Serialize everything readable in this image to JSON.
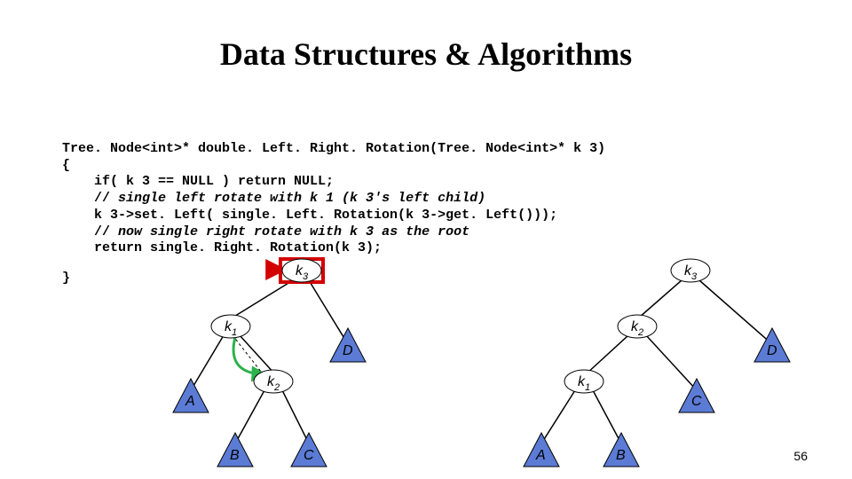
{
  "title": "Data Structures & Algorithms",
  "code": {
    "l1": "Tree. Node<int>* double. Left. Right. Rotation(Tree. Node<int>* k 3)",
    "l2": "{",
    "l3": "    if( k 3 == NULL ) return NULL;",
    "l4_prefix": "    // ",
    "l4_comment": "single left rotate with k 1 (k 3's left child)",
    "l5": "    k 3->set. Left( single. Left. Rotation(k 3->get. Left()));",
    "l6_prefix": "    // ",
    "l6_comment": "now single right rotate with k 3 as the root",
    "l7": "    return single. Right. Rotation(k 3);",
    "l8": "}"
  },
  "left_tree": {
    "root": {
      "base": "k",
      "sub": "3"
    },
    "n1": {
      "base": "k",
      "sub": "1"
    },
    "n2": {
      "base": "k",
      "sub": "2"
    },
    "tri_d": "D",
    "tri_a": "A",
    "tri_b": "B",
    "tri_c": "C"
  },
  "right_tree": {
    "root": {
      "base": "k",
      "sub": "3"
    },
    "n2": {
      "base": "k",
      "sub": "2"
    },
    "n1": {
      "base": "k",
      "sub": "1"
    },
    "tri_d": "D",
    "tri_a": "A",
    "tri_b": "B",
    "tri_c": "C"
  },
  "colors": {
    "node_stroke": "#000000",
    "node_fill": "#ffffff",
    "tri_fill": "#5b7bd5",
    "tri_stroke": "#000000",
    "edge": "#000000",
    "arrow_red": "#d40000",
    "arrow_green": "#2bb24c"
  },
  "page_number": "56"
}
